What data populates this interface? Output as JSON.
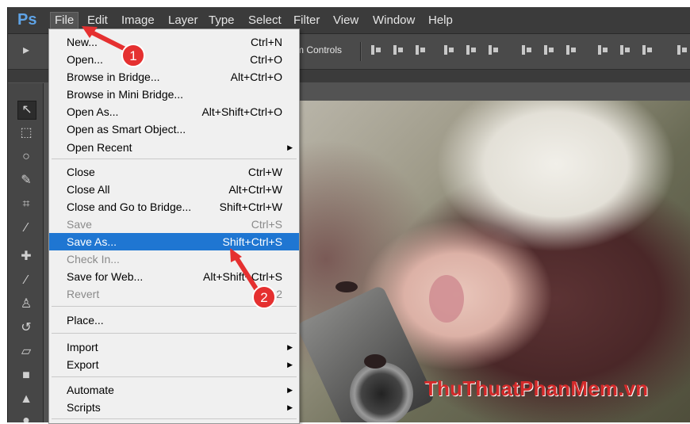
{
  "app": {
    "logo": "Ps"
  },
  "menubar": {
    "items": [
      {
        "label": "File",
        "active": true
      },
      {
        "label": "Edit"
      },
      {
        "label": "Image"
      },
      {
        "label": "Layer"
      },
      {
        "label": "Type"
      },
      {
        "label": "Select"
      },
      {
        "label": "Filter"
      },
      {
        "label": "View"
      },
      {
        "label": "Window"
      },
      {
        "label": "Help"
      }
    ]
  },
  "options_bar": {
    "transform_label": "m Controls"
  },
  "file_menu": {
    "items": [
      {
        "label": "New...",
        "shortcut": "Ctrl+N"
      },
      {
        "label": "Open...",
        "shortcut": "Ctrl+O"
      },
      {
        "label": "Browse in Bridge...",
        "shortcut": "Alt+Ctrl+O"
      },
      {
        "label": "Browse in Mini Bridge...",
        "shortcut": ""
      },
      {
        "label": "Open As...",
        "shortcut": "Alt+Shift+Ctrl+O"
      },
      {
        "label": "Open as Smart Object...",
        "shortcut": ""
      },
      {
        "label": "Open Recent",
        "shortcut": "",
        "submenu": true
      },
      {
        "label": "Close",
        "shortcut": "Ctrl+W"
      },
      {
        "label": "Close All",
        "shortcut": "Alt+Ctrl+W"
      },
      {
        "label": "Close and Go to Bridge...",
        "shortcut": "Shift+Ctrl+W"
      },
      {
        "label": "Save",
        "shortcut": "Ctrl+S",
        "disabled": true
      },
      {
        "label": "Save As...",
        "shortcut": "Shift+Ctrl+S",
        "highlighted": true
      },
      {
        "label": "Check In...",
        "shortcut": "",
        "disabled": true
      },
      {
        "label": "Save for Web...",
        "shortcut": "Alt+Shift+Ctrl+S"
      },
      {
        "label": "Revert",
        "shortcut": "F12",
        "disabled": true
      },
      {
        "label": "Place...",
        "shortcut": ""
      },
      {
        "label": "Import",
        "shortcut": "",
        "submenu": true
      },
      {
        "label": "Export",
        "shortcut": "",
        "submenu": true
      },
      {
        "label": "Automate",
        "shortcut": "",
        "submenu": true
      },
      {
        "label": "Scripts",
        "shortcut": "",
        "submenu": true
      }
    ]
  },
  "annotations": {
    "step1": "1",
    "step2": "2",
    "accent": "#e53030"
  },
  "watermark": "ThuThuatPhanMem.vn",
  "colors": {
    "menu_highlight": "#1f76d2",
    "ui_dark": "#3b3b3b",
    "ui_mid": "#535353"
  },
  "icons": [
    "arrow-move-icon",
    "marquee-icon",
    "lasso-icon",
    "quick-select-icon",
    "crop-icon",
    "eyedropper-icon",
    "healing-icon",
    "brush-icon",
    "stamp-icon",
    "history-brush-icon",
    "eraser-icon",
    "gradient-icon",
    "blur-icon",
    "dodge-icon",
    "submenu-arrow-icon"
  ]
}
